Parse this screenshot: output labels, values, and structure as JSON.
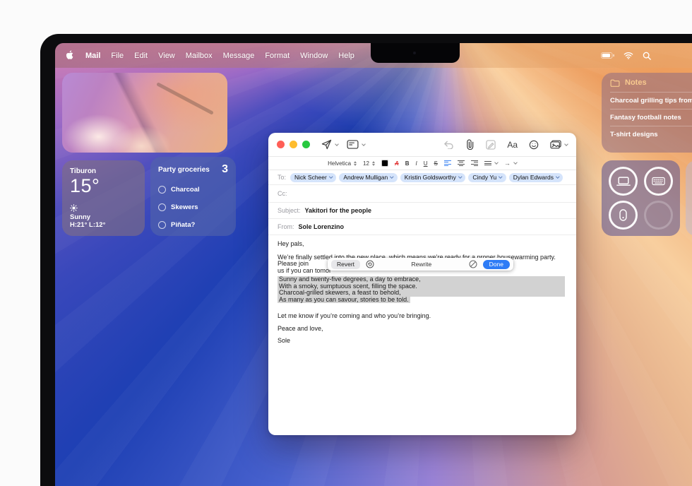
{
  "menu_bar": {
    "app": "Mail",
    "items": [
      "File",
      "Edit",
      "View",
      "Mailbox",
      "Message",
      "Format",
      "Window",
      "Help"
    ]
  },
  "widgets": {
    "weather": {
      "city": "Tiburon",
      "temp": "15°",
      "condition": "Sunny",
      "high_low": "H:21° L:12°"
    },
    "reminders": {
      "title": "Party groceries",
      "count": "3",
      "items": [
        "Charcoal",
        "Skewers",
        "Piñata?"
      ]
    },
    "notes": {
      "title": "Notes",
      "items": [
        "Charcoal grilling tips from Sh",
        "Fantasy football notes",
        "T-shirt designs"
      ]
    }
  },
  "mail": {
    "format_bar": {
      "font_name": "Helvetica",
      "font_size": "12",
      "bold": "B",
      "italic": "I",
      "underline": "U",
      "strike": "S",
      "color_a": "A",
      "aa": "Aa"
    },
    "fields": {
      "to_label": "To:",
      "cc_label": "Cc:",
      "subject_label": "Subject:",
      "from_label": "From:",
      "subject": "Yakitori for the people",
      "from": "Sole Lorenzino",
      "recipients": [
        "Nick Scheer",
        "Andrew Mulligan",
        "Kristin Goldsworthy",
        "Cindy Yu",
        "Dylan Edwards"
      ]
    },
    "body": {
      "greeting": "Hey pals,",
      "para1_line1": "We’re finally settled into the new place, which means we’re ready for a proper housewarming party. Please join",
      "para1_line2": "us if you can tomor",
      "poem": [
        "Sunny and twenty-five degrees, a day to embrace,",
        "With a smoky, sumptuous scent, filling the space.",
        "Charcoal-grilled skewers, a feast to behold,",
        "As many as you can savour, stories to be told."
      ],
      "line_rsvp": "Let me know if you’re coming and who you’re bringing.",
      "closing": "Peace and love,",
      "signature": "Sole"
    },
    "writing_tools": {
      "revert": "Revert",
      "title": "Rewrite",
      "done": "Done"
    }
  },
  "colors": {
    "accent_blue": "#2e7cf6",
    "chip_blue": "#d5e4fb",
    "highlight_gray": "#d2d2d2",
    "traffic_red": "#ff5f57",
    "traffic_yellow": "#febc2e",
    "traffic_green": "#28c840"
  }
}
